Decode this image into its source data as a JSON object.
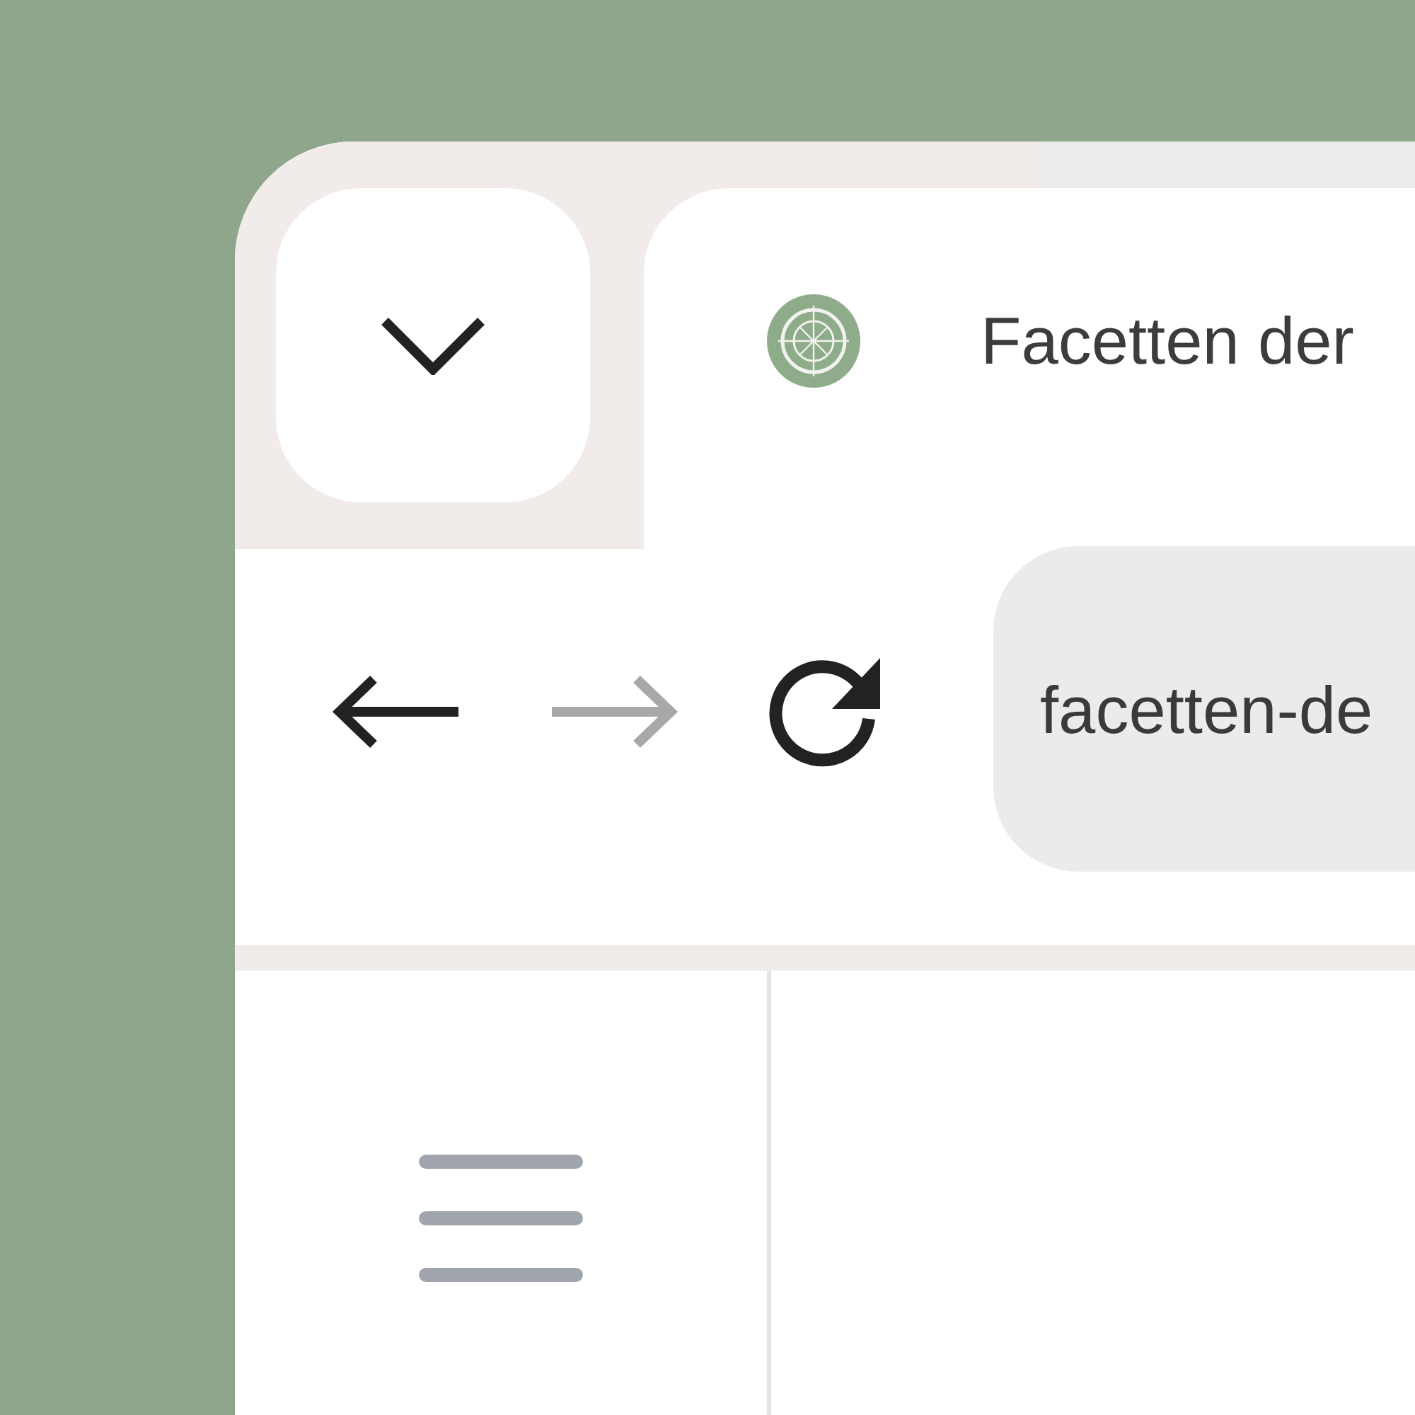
{
  "tab_dropdown": {
    "expanded": false
  },
  "tab": {
    "title": "Facetten der",
    "selected": true
  },
  "toolbar": {
    "buttons": [
      {
        "kind": "back",
        "disabled": false
      },
      {
        "kind": "forward",
        "disabled": true
      },
      {
        "kind": "reload",
        "disabled": false
      }
    ],
    "address": {
      "value": "facetten-de"
    }
  },
  "sidebar": {
    "menu_button": {
      "expanded": false
    }
  }
}
